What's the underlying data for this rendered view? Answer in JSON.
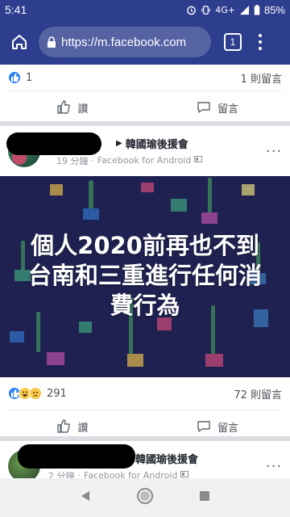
{
  "status_bar": {
    "time": "5:41",
    "network": "4G+",
    "battery": "85%"
  },
  "browser": {
    "url": "https://m.facebook.com",
    "tab_count": "1"
  },
  "prev_post": {
    "like_count": "1",
    "comment_count": "1 則留言",
    "like_label": "讚",
    "comment_label": "留言"
  },
  "post": {
    "group_name": "韓國瑜後援會",
    "time_ago": "19 分鐘",
    "source": "Facebook for Android",
    "image_caption_lines": [
      "個人2020前再也不到",
      "台南和三重進行任何消",
      "費行為"
    ],
    "reaction_count": "291",
    "comment_count": "72 則留言",
    "like_label": "讚",
    "comment_label": "留言"
  },
  "next_post": {
    "group_name": "韓國瑜後援會",
    "time_ago": "2 分鐘",
    "source": "Facebook for Android"
  },
  "colors": {
    "chrome_bar": "#2d3e8e",
    "omnibox": "#5663a3",
    "like_blue": "#2d82f5",
    "image_bg": "#1f2150"
  },
  "icons": [
    "home-icon",
    "lock-icon",
    "tab-switcher-icon",
    "menu-icon",
    "like-icon",
    "comment-icon",
    "back-icon",
    "home-nav-icon",
    "recents-icon"
  ]
}
